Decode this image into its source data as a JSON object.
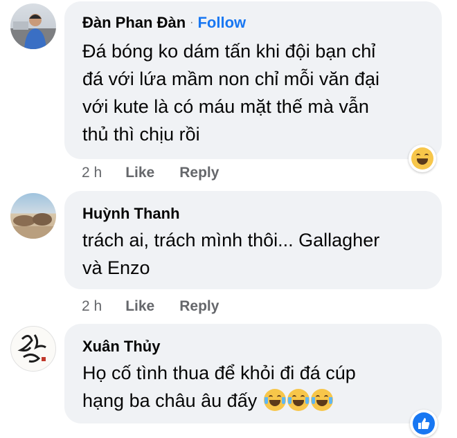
{
  "comments": [
    {
      "author": "Đàn Phan Đàn",
      "separator": "·",
      "follow_label": "Follow",
      "lines": [
        "Đá bóng ko dám tấn khi đội bạn chỉ",
        "đá với lứa mầm non chỉ mỗi văn đại",
        "với kute là có máu mặt thế mà vẫn",
        "thủ thì chịu rồi"
      ],
      "time": "2 h",
      "like_label": "Like",
      "reply_label": "Reply",
      "reaction_icon": "grinning-face-icon"
    },
    {
      "author": "Huỳnh Thanh",
      "lines": [
        "trách ai, trách mình thôi... Gallagher",
        "và Enzo"
      ],
      "time": "2 h",
      "like_label": "Like",
      "reply_label": "Reply"
    },
    {
      "author": "Xuân Thủy",
      "lines": [
        "Họ cố tình thua để khỏi đi đá cúp",
        "hạng ba châu âu đấy"
      ],
      "inline_emojis": [
        "tears-of-joy-icon",
        "tears-of-joy-icon",
        "tears-of-joy-icon"
      ],
      "reaction_icon": "like-icon"
    }
  ],
  "colors": {
    "bubble": "#f0f2f5",
    "follow": "#1877f2",
    "meta": "#65676b",
    "emoji": "#f7c64a"
  }
}
